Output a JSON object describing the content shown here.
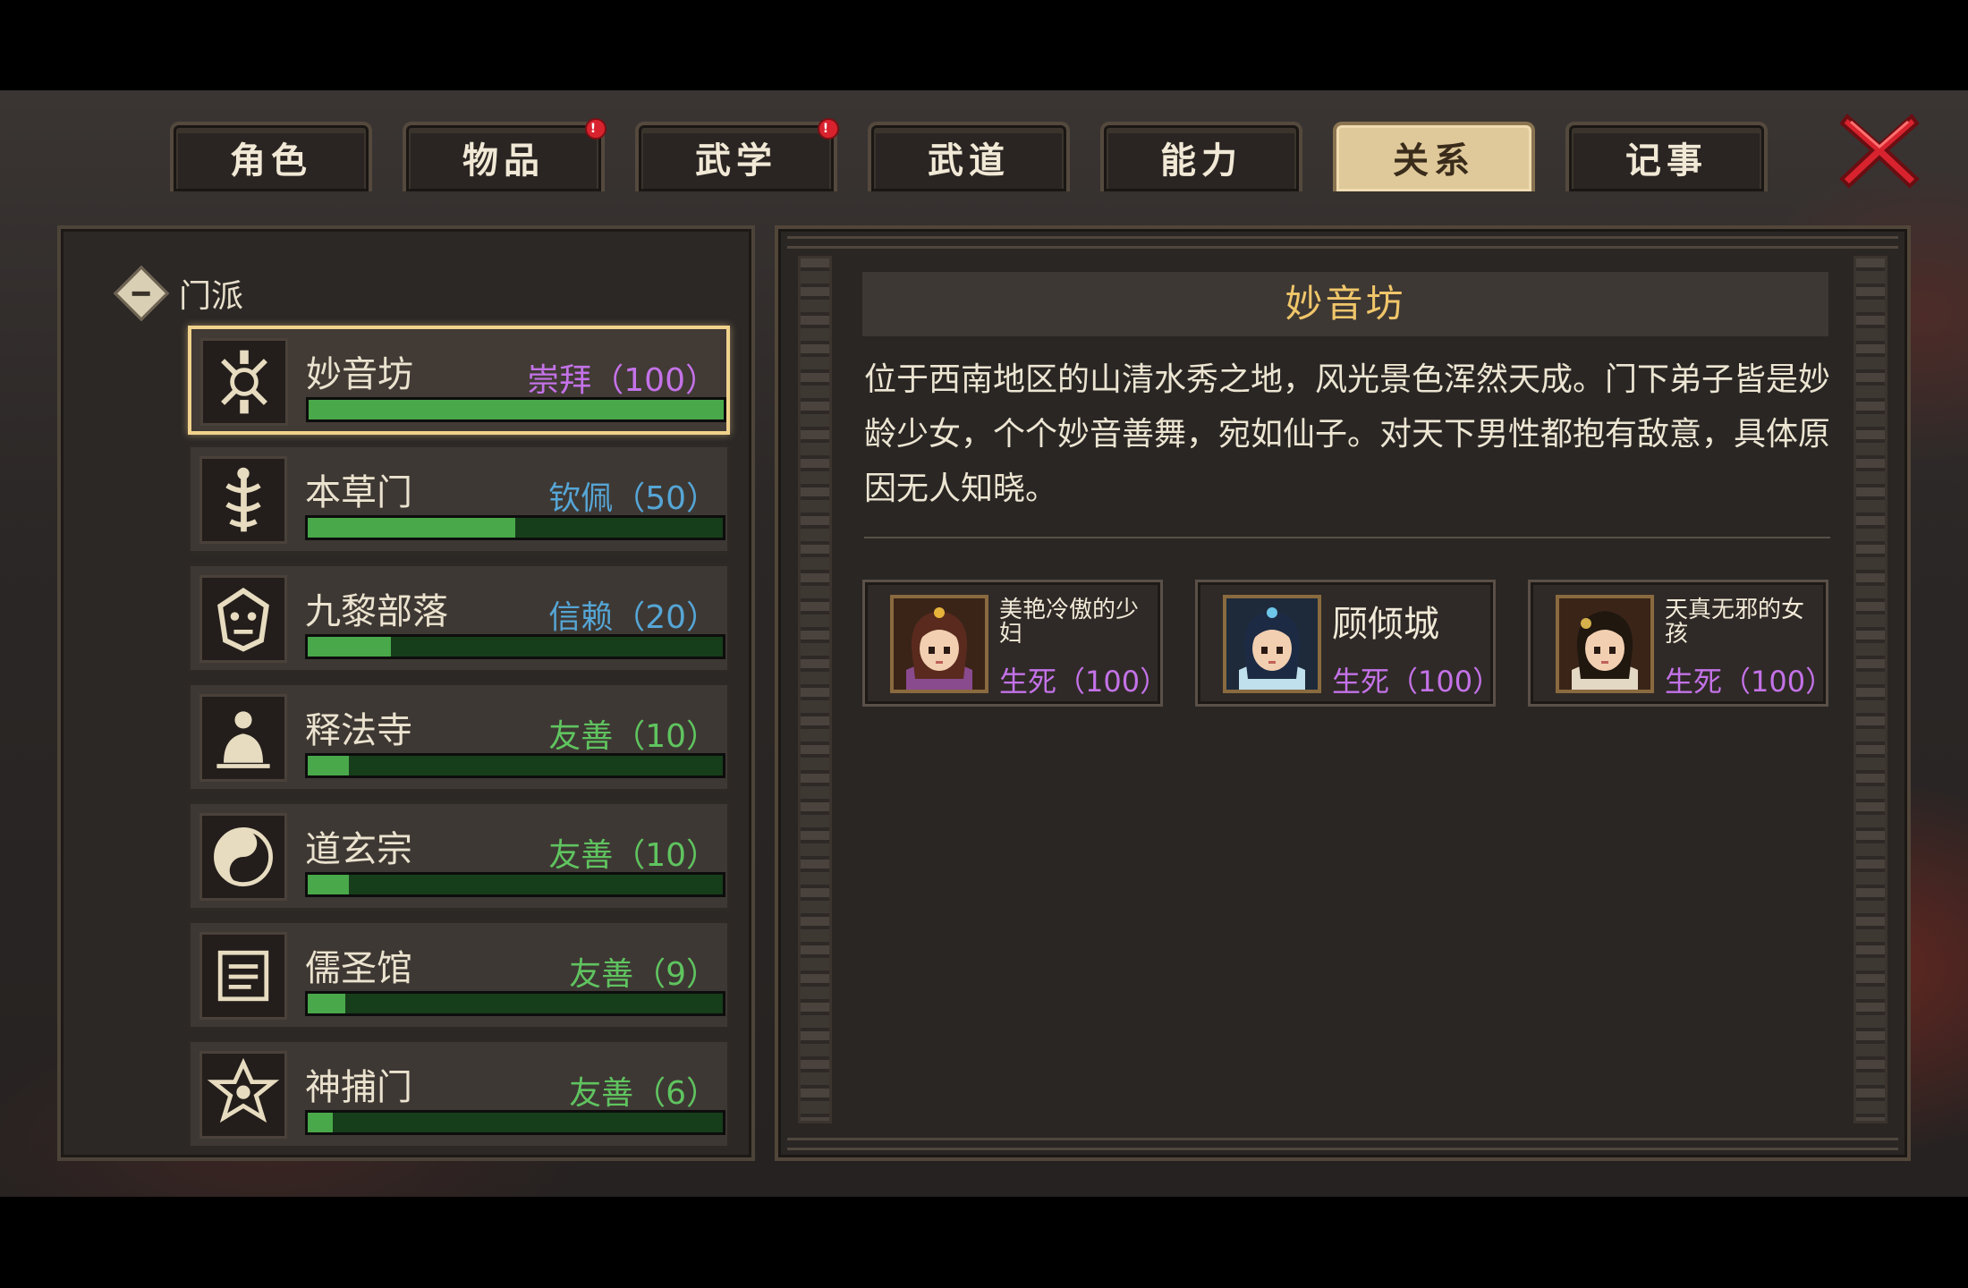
{
  "tabs": [
    {
      "label": "角色",
      "active": false,
      "alert": false
    },
    {
      "label": "物品",
      "active": false,
      "alert": true
    },
    {
      "label": "武学",
      "active": false,
      "alert": true
    },
    {
      "label": "武道",
      "active": false,
      "alert": false
    },
    {
      "label": "能力",
      "active": false,
      "alert": false
    },
    {
      "label": "关系",
      "active": true,
      "alert": false
    },
    {
      "label": "记事",
      "active": false,
      "alert": false
    }
  ],
  "alert_glyph": "!",
  "colors": {
    "accent_gold": "#f0c66a",
    "bar_fill": "#49a84a",
    "bar_track": "#163e1a",
    "close_red": "#d8232e"
  },
  "group": {
    "label": "门派",
    "icon": "collapse-minus-icon"
  },
  "sects": [
    {
      "name": "妙音坊",
      "status": "崇拜（100）",
      "status_color": "#c472e8",
      "level": 1.0,
      "icon": "lotus-bell-emblem-icon",
      "selected": true
    },
    {
      "name": "本草门",
      "status": "钦佩（50）",
      "status_color": "#55a6d6",
      "level": 0.5,
      "icon": "caduceus-emblem-icon",
      "selected": false
    },
    {
      "name": "九黎部落",
      "status": "信赖（20）",
      "status_color": "#55a6d6",
      "level": 0.2,
      "icon": "tribal-mask-emblem-icon",
      "selected": false
    },
    {
      "name": "释法寺",
      "status": "友善（10）",
      "status_color": "#5fc45f",
      "level": 0.1,
      "icon": "buddha-emblem-icon",
      "selected": false
    },
    {
      "name": "道玄宗",
      "status": "友善（10）",
      "status_color": "#5fc45f",
      "level": 0.1,
      "icon": "yin-yang-emblem-icon",
      "selected": false
    },
    {
      "name": "儒圣馆",
      "status": "友善（9）",
      "status_color": "#5fc45f",
      "level": 0.09,
      "icon": "scroll-emblem-icon",
      "selected": false
    },
    {
      "name": "神捕门",
      "status": "友善（6）",
      "status_color": "#5fc45f",
      "level": 0.06,
      "icon": "badge-emblem-icon",
      "selected": false
    }
  ],
  "detail": {
    "title": "妙音坊",
    "description": "位于西南地区的山清水秀之地，风光景色浑然天成。门下弟子皆是妙龄少女，个个妙音善舞，宛如仙子。对天下男性都抱有敌意，具体原因无人知晓。",
    "members": [
      {
        "name": "美艳冷傲的少妇",
        "relation": "生死（100）",
        "name_size": "small",
        "icon": "woman-portrait-icon"
      },
      {
        "name": "顾倾城",
        "relation": "生死（100）",
        "name_size": "big",
        "icon": "blue-hair-woman-portrait-icon"
      },
      {
        "name": "天真无邪的女孩",
        "relation": "生死（100）",
        "name_size": "small",
        "icon": "girl-portrait-icon"
      }
    ]
  }
}
